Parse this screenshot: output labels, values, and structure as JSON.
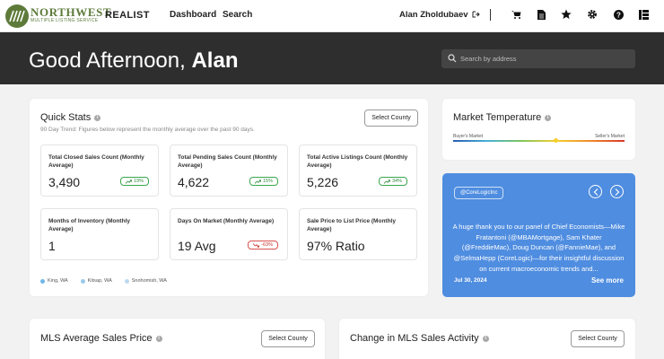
{
  "brand": {
    "name": "NORTHWEST",
    "sub": "MULTIPLE LISTING SERVICE",
    "product": "REALIST"
  },
  "nav": {
    "links": [
      "Dashboard",
      "Search"
    ],
    "user": "Alan Zholdubaev"
  },
  "hero": {
    "greeting": "Good Afternoon,",
    "name": "Alan",
    "search_placeholder": "Search by address"
  },
  "quick_stats": {
    "title": "Quick Stats",
    "subtitle": "90 Day Trend: Figures below represent the monthly average over the past 90 days.",
    "select_label": "Select County",
    "stats": [
      {
        "label": "Total Closed Sales Count (Monthly Average)",
        "value": "3,490",
        "badge": "19%",
        "trend": "up"
      },
      {
        "label": "Total Pending Sales Count (Monthly Average)",
        "value": "4,622",
        "badge": "15%",
        "trend": "up"
      },
      {
        "label": "Total Active Listings Count (Monthly Average)",
        "value": "5,226",
        "badge": "34%",
        "trend": "up"
      },
      {
        "label": "Months of Inventory (Monthly Average)",
        "value": "1",
        "badge": "",
        "trend": ""
      },
      {
        "label": "Days On Market (Monthly Average)",
        "value": "19 Avg",
        "badge": "-63%",
        "trend": "down"
      },
      {
        "label": "Sale Price to List Price (Monthly Average)",
        "value": "97% Ratio",
        "badge": "",
        "trend": ""
      }
    ],
    "legend": [
      {
        "label": "King, WA",
        "color": "#6fb6e8"
      },
      {
        "label": "Kitsap, WA",
        "color": "#9ac8ea"
      },
      {
        "label": "Snohomish, WA",
        "color": "#bcd9ef"
      }
    ]
  },
  "market_temperature": {
    "title": "Market Temperature",
    "left_label": "Buyer's Market",
    "right_label": "Seller's Market",
    "level": 0.6
  },
  "promo": {
    "tag": "@CoreLogicInc",
    "text": "A huge thank you to our panel of Chief Economists—Mike Fratantoni (@MBAMortgage), Sam Khater (@FreddieMac), Doug Duncan (@FannieMae), and @SelmaHepp (CoreLogic)—for their insightful discussion on current macroeconomic trends and...",
    "date": "Jul 30, 2024",
    "more": "See more"
  },
  "avg_sales_price": {
    "title": "MLS Average Sales Price",
    "select_label": "Select County"
  },
  "sales_activity": {
    "title": "Change in MLS Sales Activity",
    "select_label": "Select County"
  }
}
